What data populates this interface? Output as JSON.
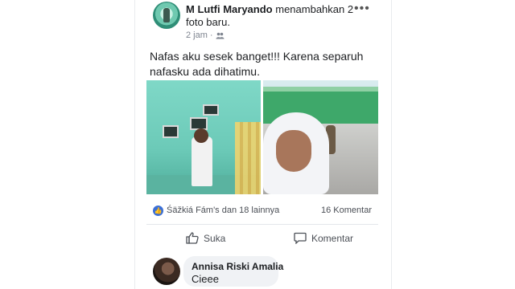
{
  "post": {
    "author": "M Lutfi Maryando",
    "action_text": "menambahkan 2 foto baru.",
    "time": "2 jam",
    "text": "Nafas aku sesek banget!!! Karena separuh nafasku ada dihatimu."
  },
  "reactions": {
    "names": "Śäžkiá Fám's dan 18 lainnya",
    "comment_count": "16 Komentar"
  },
  "actions": {
    "like_label": "Suka",
    "comment_label": "Komentar"
  },
  "comment": {
    "author": "Annisa Riski Amalia",
    "text": "Cieee"
  },
  "icons": [
    "more-icon",
    "public-audience-icon",
    "like-badge-icon",
    "thumbs-up-icon",
    "comment-icon"
  ],
  "colors": {
    "like_blue": "#3b6fd6",
    "text_dark": "#1c1e21",
    "meta_gray": "#7f8590",
    "bubble_gray": "#f0f2f5"
  }
}
